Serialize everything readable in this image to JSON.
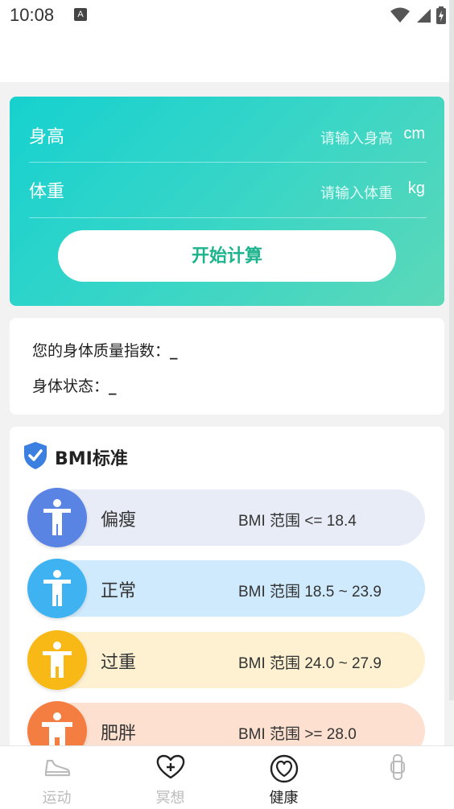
{
  "status_bar": {
    "time": "10:08",
    "notification_icon": "A"
  },
  "calculator": {
    "height_label": "身高",
    "height_placeholder": "请输入身高",
    "height_unit": "cm",
    "weight_label": "体重",
    "weight_placeholder": "请输入体重",
    "weight_unit": "kg",
    "calculate_button": "开始计算",
    "gradient_colors": [
      "#16d1cf",
      "#5cd8b8"
    ]
  },
  "result": {
    "bmi_label": "您的身体质量指数：",
    "bmi_value": "_",
    "status_label": "身体状态：",
    "status_value": "_"
  },
  "standard": {
    "title": "BMI标准",
    "title_icon": "shield-check-icon",
    "rows": [
      {
        "name": "偏瘦",
        "range": "BMI 范围 <= 18.4",
        "pill_color": "#e8ecf6",
        "circle_color": "#5a84e3"
      },
      {
        "name": "正常",
        "range": "BMI 范围 18.5 ~ 23.9",
        "pill_color": "#cfeafd",
        "circle_color": "#3fb3f2"
      },
      {
        "name": "过重",
        "range": "BMI 范围 24.0 ~ 27.9",
        "pill_color": "#fdf1d2",
        "circle_color": "#f8b816"
      },
      {
        "name": "肥胖",
        "range": "BMI 范围 >= 28.0",
        "pill_color": "#fde0cf",
        "circle_color": "#f47e41"
      }
    ]
  },
  "bottom_nav": {
    "items": [
      {
        "label": "运动",
        "icon": "sneaker-icon",
        "active": false
      },
      {
        "label": "冥想",
        "icon": "heart-plus-icon",
        "active": false
      },
      {
        "label": "健康",
        "icon": "heart-circle-icon",
        "active": true
      },
      {
        "label": "",
        "icon": "watch-icon",
        "active": false
      }
    ]
  }
}
